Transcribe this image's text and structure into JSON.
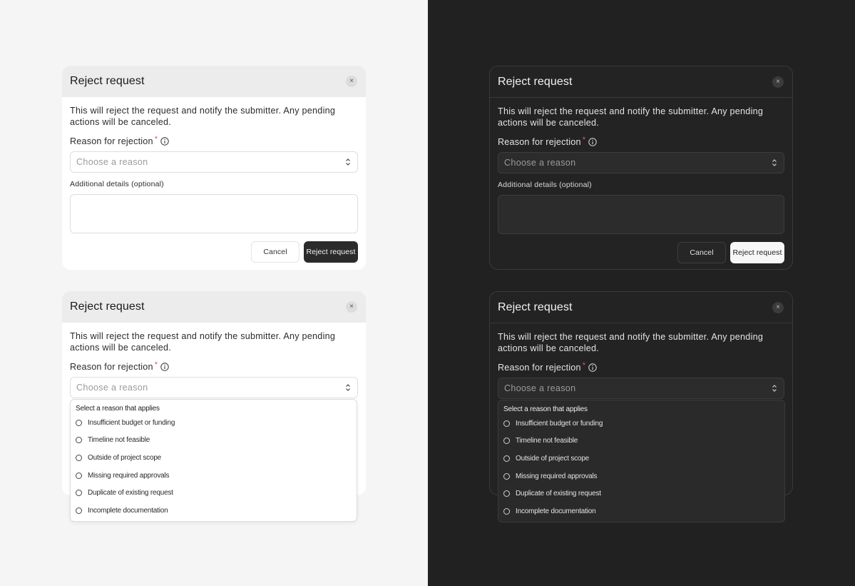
{
  "dialog": {
    "title": "Reject request",
    "description": "This will reject the request and notify the submitter. Any pending actions will be canceled.",
    "reason_label": "Reason for rejection",
    "required_mark": "*",
    "select_placeholder": "Choose a reason",
    "details_label": "Additional details (optional)",
    "details_value": "",
    "cancel_label": "Cancel",
    "reject_label": "Reject request",
    "close_glyph": "×"
  },
  "dropdown": {
    "heading": "Select a reason that applies",
    "options": [
      "Insufficient budget or funding",
      "Timeline not feasible",
      "Outside of project scope",
      "Missing required approvals",
      "Duplicate of existing request",
      "Incomplete documentation"
    ]
  },
  "icons": {
    "close": "close-icon",
    "info": "info-icon",
    "select": "chevron-up-down-icon",
    "radio": "radio-icon"
  },
  "colors": {
    "light_background": "#f5f5f5",
    "dark_background": "#212121",
    "required": "#e05a5a",
    "light_primary_button": "#2b2b2b",
    "dark_primary_button": "#f7f7f7"
  }
}
